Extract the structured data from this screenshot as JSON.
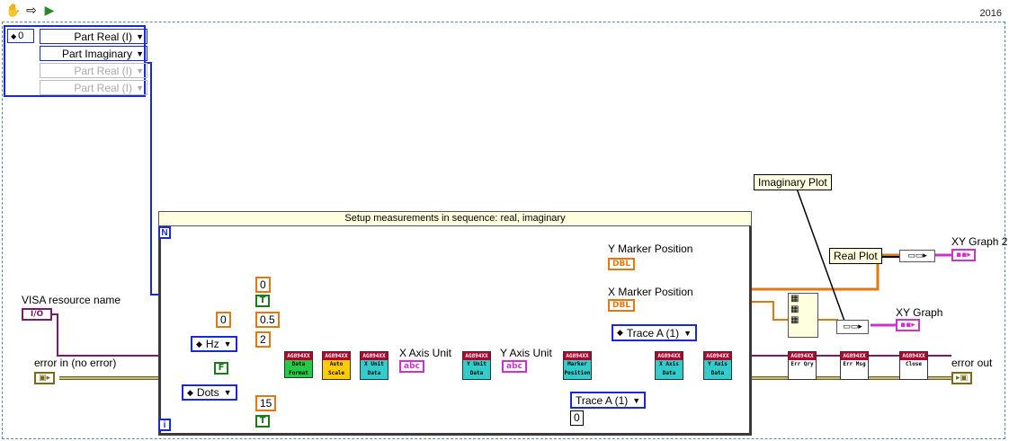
{
  "toolbar": {
    "year": "2016",
    "icons": [
      "hand-icon",
      "arrow-icon",
      "run-icon"
    ]
  },
  "array_control": {
    "index": "0",
    "items": [
      "Part Real (I)",
      "Part Imaginary",
      "Part Real (I)",
      "Part Real (I)"
    ]
  },
  "sequence": {
    "title": "Setup measurements in sequence: real, imaginary",
    "n_label": "N",
    "i_label": "i"
  },
  "labels": {
    "visa": "VISA resource name",
    "visa_terminal": "I/O",
    "error_in": "error in (no error)",
    "error_out": "error out",
    "imag_plot": "Imaginary Plot",
    "real_plot": "Real Plot",
    "xy_graph2": "XY Graph 2",
    "xy_graph": "XY Graph",
    "y_marker": "Y Marker Position",
    "x_marker": "X Marker Position",
    "x_axis_unit": "X Axis Unit",
    "y_axis_unit": "Y Axis Unit"
  },
  "constants": {
    "hz": "Hz",
    "dots": "Dots",
    "false_const": "F",
    "true1": "T",
    "true2": "T",
    "n0": "0",
    "n05": "0.5",
    "n2": "2",
    "n0b": "0",
    "n15": "15",
    "trace_a_top": "Trace A (1)",
    "trace_a_bottom": "Trace A (1)",
    "n0c": "0",
    "dbl": "DBL",
    "abc": "abc"
  },
  "vis": [
    {
      "head": "AG894XX",
      "body": "Data Format"
    },
    {
      "head": "AG894XX",
      "body": "Auto Scale"
    },
    {
      "head": "AG894XX",
      "body": "X Unit Data"
    },
    {
      "head": "AG894XX",
      "body": "Y Unit Data"
    },
    {
      "head": "AG894XX",
      "body": "Marker Position Data"
    },
    {
      "head": "AG894XX",
      "body": "X Axis Data"
    },
    {
      "head": "AG894XX",
      "body": "Y Axis Data"
    },
    {
      "head": "AG894XX",
      "body": "Err Qry"
    },
    {
      "head": "AG894XX",
      "body": "Err Msg"
    },
    {
      "head": "AG894XX",
      "body": "Close"
    }
  ],
  "colors": {
    "wire_error": "#6b5a1a",
    "wire_visa": "#7a1a6a",
    "wire_num": "#e07a10",
    "wire_enum": "#1a2ad0",
    "wire_bool": "#1d7a1d"
  }
}
